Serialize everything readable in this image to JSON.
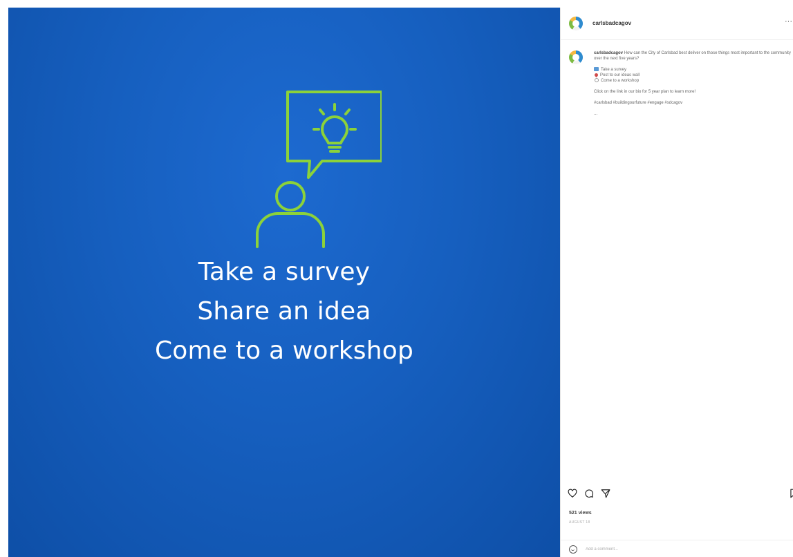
{
  "media": {
    "lines": [
      "Take a survey",
      "Share an idea",
      "Come to a workshop"
    ],
    "accent_color": "#8cd23a",
    "background_color": "#165fbf"
  },
  "post": {
    "username": "carlsbadcagov",
    "caption": {
      "text": "How can the City of Carlsbad best deliver on those things most important to the community over the next five years?",
      "items": [
        {
          "icon": "survey-icon",
          "label": "Take a survey"
        },
        {
          "icon": "pin-icon",
          "label": "Post to our ideas wall"
        },
        {
          "icon": "workshop-icon",
          "label": "Come to a workshop"
        }
      ],
      "link_line": "Click on the link in our bio for 5 year plan to learn more!",
      "hashtags": "#carlsbad #buildingourfuture #engage #sdcagov",
      "more": "..."
    },
    "views": "521 views",
    "posted_ago": "AUGUST 18",
    "comment_placeholder": "Add a comment..."
  }
}
